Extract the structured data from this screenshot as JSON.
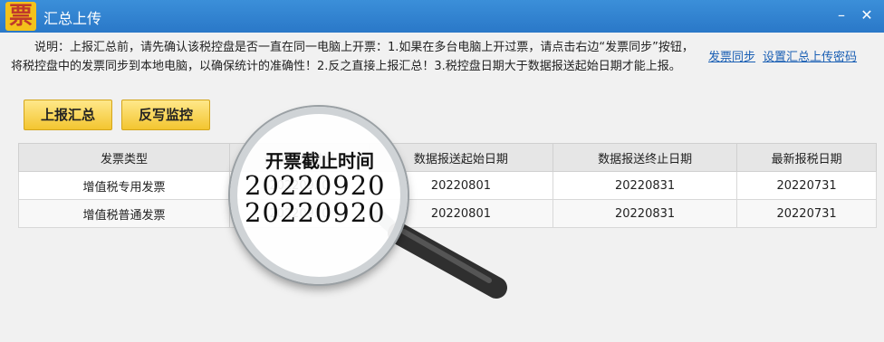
{
  "window": {
    "app_icon_glyph": "票",
    "title": "汇总上传",
    "controls": {
      "minimize": "–",
      "close": "✕"
    }
  },
  "notice": {
    "text": "说明：上报汇总前，请先确认该税控盘是否一直在同一电脑上开票：1.如果在多台电脑上开过票，请点击右边“发票同步”按钮，将税控盘中的发票同步到本地电脑，以确保统计的准确性！2.反之直接上报汇总！3.税控盘日期大于数据报送起始日期才能上报。"
  },
  "links": {
    "invoice_sync": "发票同步",
    "set_password": "设置汇总上传密码"
  },
  "buttons": {
    "report_summary": "上报汇总",
    "writeback_monitor": "反写监控"
  },
  "table": {
    "headers": [
      "发票类型",
      "开票截止时间",
      "数据报送起始日期",
      "数据报送终止日期",
      "最新报税日期"
    ],
    "rows": [
      [
        "增值税专用发票",
        "20220920",
        "20220801",
        "20220831",
        "20220731"
      ],
      [
        "增值税普通发票",
        "20220920",
        "20220801",
        "20220831",
        "20220731"
      ]
    ]
  },
  "magnifier": {
    "label": "开票截止时间",
    "values": [
      "20220920",
      "20220920"
    ]
  },
  "colors": {
    "titlebar": "#2a78c8",
    "button": "#f3c530",
    "link": "#1a5fb4"
  }
}
